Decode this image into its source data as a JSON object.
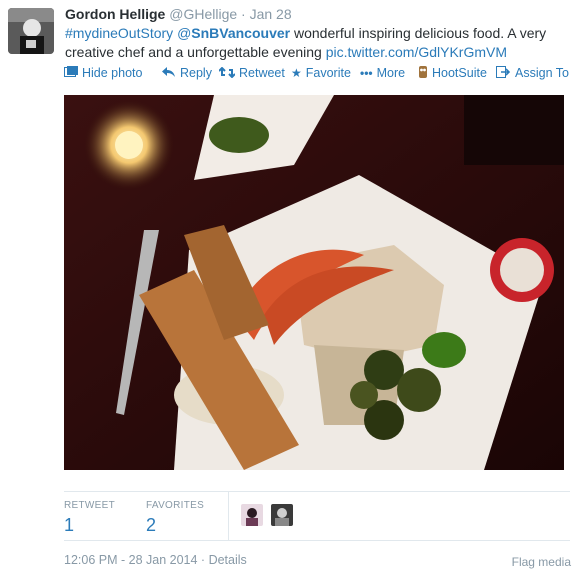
{
  "tweet": {
    "name": "Gordon Hellige",
    "handle": "@GHellige",
    "sep": "·",
    "date": "Jan 28",
    "hashtag": "#mydineOutStory",
    "mention": "@SnBVancouver",
    "body_text": " wonderful inspiring delicious food. A very creative chef and a unforgettable evening ",
    "link": "pic.twitter.com/GdlYKrGmVM"
  },
  "actions": {
    "hide_photo": "Hide photo",
    "reply": "Reply",
    "retweet": "Retweet",
    "favorite": "Favorite",
    "more": "More",
    "hootsuite": "HootSuite",
    "assign_to": "Assign To"
  },
  "stats": {
    "retweet_label": "RETWEET",
    "retweet_count": "1",
    "favorites_label": "FAVORITES",
    "favorites_count": "2"
  },
  "footer": {
    "timestamp": "12:06 PM - 28 Jan 2014",
    "sep": "·",
    "details": "Details",
    "flag_media": "Flag media"
  },
  "colors": {
    "link": "#2b7bb9",
    "muted": "#8899a6"
  },
  "icons": {
    "hide_photo": "photo-icon",
    "reply": "reply-icon",
    "retweet": "retweet-icon",
    "favorite": "star-icon",
    "more": "more-dots-icon",
    "hootsuite": "hootsuite-owl-icon",
    "assign_to": "assign-icon"
  }
}
